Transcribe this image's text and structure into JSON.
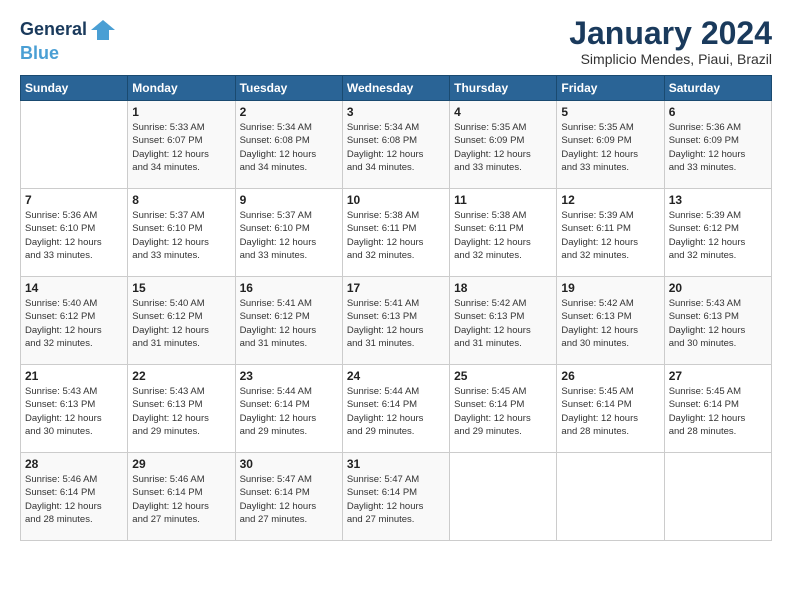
{
  "logo": {
    "line1": "General",
    "line2": "Blue"
  },
  "header": {
    "month": "January 2024",
    "location": "Simplicio Mendes, Piaui, Brazil"
  },
  "days_of_week": [
    "Sunday",
    "Monday",
    "Tuesday",
    "Wednesday",
    "Thursday",
    "Friday",
    "Saturday"
  ],
  "weeks": [
    [
      {
        "day": "",
        "info": ""
      },
      {
        "day": "1",
        "info": "Sunrise: 5:33 AM\nSunset: 6:07 PM\nDaylight: 12 hours\nand 34 minutes."
      },
      {
        "day": "2",
        "info": "Sunrise: 5:34 AM\nSunset: 6:08 PM\nDaylight: 12 hours\nand 34 minutes."
      },
      {
        "day": "3",
        "info": "Sunrise: 5:34 AM\nSunset: 6:08 PM\nDaylight: 12 hours\nand 34 minutes."
      },
      {
        "day": "4",
        "info": "Sunrise: 5:35 AM\nSunset: 6:09 PM\nDaylight: 12 hours\nand 33 minutes."
      },
      {
        "day": "5",
        "info": "Sunrise: 5:35 AM\nSunset: 6:09 PM\nDaylight: 12 hours\nand 33 minutes."
      },
      {
        "day": "6",
        "info": "Sunrise: 5:36 AM\nSunset: 6:09 PM\nDaylight: 12 hours\nand 33 minutes."
      }
    ],
    [
      {
        "day": "7",
        "info": "Sunrise: 5:36 AM\nSunset: 6:10 PM\nDaylight: 12 hours\nand 33 minutes."
      },
      {
        "day": "8",
        "info": "Sunrise: 5:37 AM\nSunset: 6:10 PM\nDaylight: 12 hours\nand 33 minutes."
      },
      {
        "day": "9",
        "info": "Sunrise: 5:37 AM\nSunset: 6:10 PM\nDaylight: 12 hours\nand 33 minutes."
      },
      {
        "day": "10",
        "info": "Sunrise: 5:38 AM\nSunset: 6:11 PM\nDaylight: 12 hours\nand 32 minutes."
      },
      {
        "day": "11",
        "info": "Sunrise: 5:38 AM\nSunset: 6:11 PM\nDaylight: 12 hours\nand 32 minutes."
      },
      {
        "day": "12",
        "info": "Sunrise: 5:39 AM\nSunset: 6:11 PM\nDaylight: 12 hours\nand 32 minutes."
      },
      {
        "day": "13",
        "info": "Sunrise: 5:39 AM\nSunset: 6:12 PM\nDaylight: 12 hours\nand 32 minutes."
      }
    ],
    [
      {
        "day": "14",
        "info": "Sunrise: 5:40 AM\nSunset: 6:12 PM\nDaylight: 12 hours\nand 32 minutes."
      },
      {
        "day": "15",
        "info": "Sunrise: 5:40 AM\nSunset: 6:12 PM\nDaylight: 12 hours\nand 31 minutes."
      },
      {
        "day": "16",
        "info": "Sunrise: 5:41 AM\nSunset: 6:12 PM\nDaylight: 12 hours\nand 31 minutes."
      },
      {
        "day": "17",
        "info": "Sunrise: 5:41 AM\nSunset: 6:13 PM\nDaylight: 12 hours\nand 31 minutes."
      },
      {
        "day": "18",
        "info": "Sunrise: 5:42 AM\nSunset: 6:13 PM\nDaylight: 12 hours\nand 31 minutes."
      },
      {
        "day": "19",
        "info": "Sunrise: 5:42 AM\nSunset: 6:13 PM\nDaylight: 12 hours\nand 30 minutes."
      },
      {
        "day": "20",
        "info": "Sunrise: 5:43 AM\nSunset: 6:13 PM\nDaylight: 12 hours\nand 30 minutes."
      }
    ],
    [
      {
        "day": "21",
        "info": "Sunrise: 5:43 AM\nSunset: 6:13 PM\nDaylight: 12 hours\nand 30 minutes."
      },
      {
        "day": "22",
        "info": "Sunrise: 5:43 AM\nSunset: 6:13 PM\nDaylight: 12 hours\nand 29 minutes."
      },
      {
        "day": "23",
        "info": "Sunrise: 5:44 AM\nSunset: 6:14 PM\nDaylight: 12 hours\nand 29 minutes."
      },
      {
        "day": "24",
        "info": "Sunrise: 5:44 AM\nSunset: 6:14 PM\nDaylight: 12 hours\nand 29 minutes."
      },
      {
        "day": "25",
        "info": "Sunrise: 5:45 AM\nSunset: 6:14 PM\nDaylight: 12 hours\nand 29 minutes."
      },
      {
        "day": "26",
        "info": "Sunrise: 5:45 AM\nSunset: 6:14 PM\nDaylight: 12 hours\nand 28 minutes."
      },
      {
        "day": "27",
        "info": "Sunrise: 5:45 AM\nSunset: 6:14 PM\nDaylight: 12 hours\nand 28 minutes."
      }
    ],
    [
      {
        "day": "28",
        "info": "Sunrise: 5:46 AM\nSunset: 6:14 PM\nDaylight: 12 hours\nand 28 minutes."
      },
      {
        "day": "29",
        "info": "Sunrise: 5:46 AM\nSunset: 6:14 PM\nDaylight: 12 hours\nand 27 minutes."
      },
      {
        "day": "30",
        "info": "Sunrise: 5:47 AM\nSunset: 6:14 PM\nDaylight: 12 hours\nand 27 minutes."
      },
      {
        "day": "31",
        "info": "Sunrise: 5:47 AM\nSunset: 6:14 PM\nDaylight: 12 hours\nand 27 minutes."
      },
      {
        "day": "",
        "info": ""
      },
      {
        "day": "",
        "info": ""
      },
      {
        "day": "",
        "info": ""
      }
    ]
  ]
}
